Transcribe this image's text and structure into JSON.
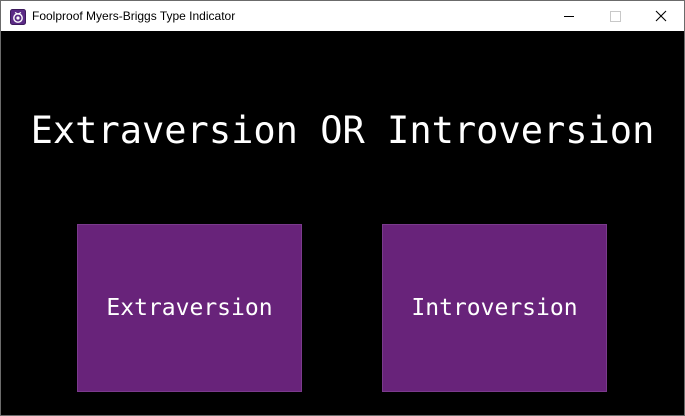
{
  "window": {
    "title": "Foolproof Myers-Briggs Type Indicator",
    "icon": "app-icon"
  },
  "controls": {
    "minimize_icon": "minimize-icon",
    "maximize_icon": "maximize-icon",
    "close_icon": "close-icon"
  },
  "main": {
    "heading": "Extraversion OR Introversion",
    "choices": [
      {
        "label": "Extraversion"
      },
      {
        "label": "Introversion"
      }
    ]
  },
  "colors": {
    "background": "#000000",
    "button": "#68237a",
    "text": "#ffffff"
  }
}
